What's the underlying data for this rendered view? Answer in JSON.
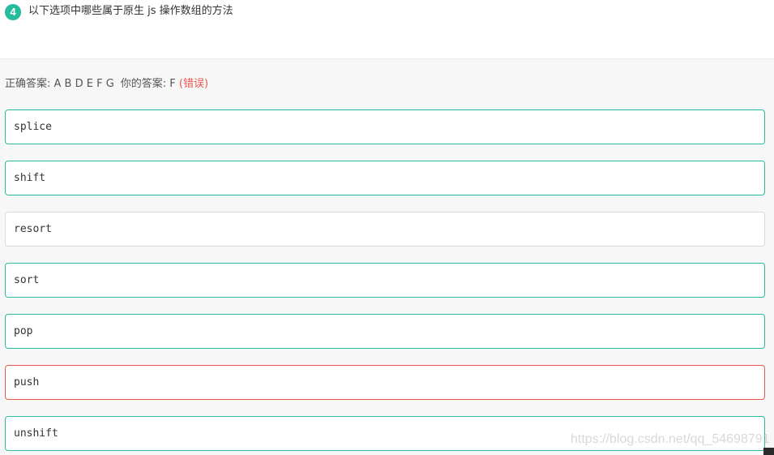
{
  "question": {
    "number": "4",
    "text": "以下选项中哪些属于原生 js 操作数组的方法"
  },
  "answer": {
    "correct_label": "正确答案: ",
    "correct_value": "A B D E F G",
    "yours_label": "你的答案: ",
    "yours_value": "F",
    "verdict": "(错误)"
  },
  "options": [
    {
      "text": "splice"
    },
    {
      "text": "shift"
    },
    {
      "text": "resort"
    },
    {
      "text": "sort"
    },
    {
      "text": "pop"
    },
    {
      "text": "push"
    },
    {
      "text": "unshift"
    }
  ],
  "watermark": "https://blog.csdn.net/qq_54698791",
  "colors": {
    "accent": "#25bb9b",
    "error": "#e8574d",
    "neutral_border": "#d9d9d9"
  }
}
